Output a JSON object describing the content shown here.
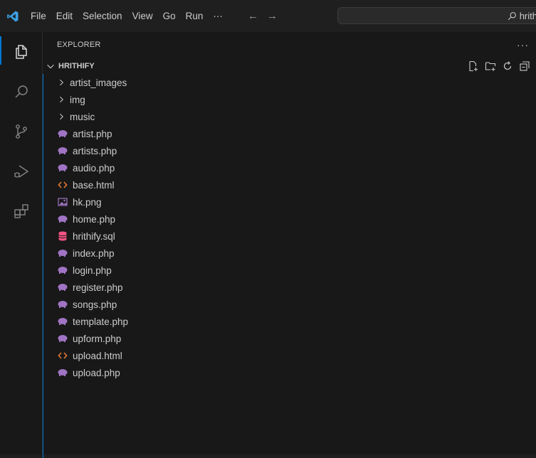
{
  "menu": {
    "items": [
      "File",
      "Edit",
      "Selection",
      "View",
      "Go",
      "Run"
    ],
    "more": "···"
  },
  "search": {
    "text": "hrith"
  },
  "explorer": {
    "title": "EXPLORER",
    "more": "···",
    "root": "HRITHIFY",
    "folders": [
      "artist_images",
      "img",
      "music"
    ],
    "files": [
      {
        "name": "artist.php",
        "type": "php"
      },
      {
        "name": "artists.php",
        "type": "php"
      },
      {
        "name": "audio.php",
        "type": "php"
      },
      {
        "name": "base.html",
        "type": "html"
      },
      {
        "name": "hk.png",
        "type": "image"
      },
      {
        "name": "home.php",
        "type": "php"
      },
      {
        "name": "hrithify.sql",
        "type": "sql"
      },
      {
        "name": "index.php",
        "type": "php"
      },
      {
        "name": "login.php",
        "type": "php"
      },
      {
        "name": "register.php",
        "type": "php"
      },
      {
        "name": "songs.php",
        "type": "php"
      },
      {
        "name": "template.php",
        "type": "php"
      },
      {
        "name": "upform.php",
        "type": "php"
      },
      {
        "name": "upload.html",
        "type": "html"
      },
      {
        "name": "upload.php",
        "type": "php"
      }
    ]
  },
  "colors": {
    "accent": "#0078d4",
    "php": "#a074c4",
    "html": "#e37933",
    "sql": "#f55385",
    "image": "#a074c4"
  }
}
